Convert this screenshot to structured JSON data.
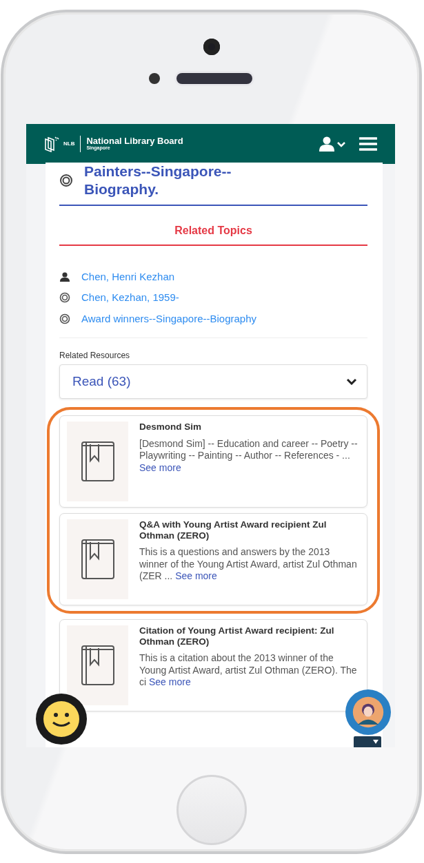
{
  "navbar": {
    "logo_mark": "NLB",
    "logo_text": "National Library Board",
    "logo_subtext": "Singapore"
  },
  "subject": {
    "title": "Painters--Singapore--Biography."
  },
  "related_topics": {
    "heading": "Related Topics",
    "items": [
      {
        "kind": "person",
        "label": "Chen, Henri Kezhan"
      },
      {
        "kind": "subject",
        "label": "Chen, Kezhan, 1959-"
      },
      {
        "kind": "subject",
        "label": "Award winners--Singapore--Biography"
      }
    ]
  },
  "related_resources": {
    "label": "Related Resources",
    "value": "Read (63)"
  },
  "results": [
    {
      "title": "Desmond Sim",
      "description": "[Desmond Sim] -- Education and career -- Poetry -- Playwriting -- Painting -- Author -- References - ...",
      "link": "See more",
      "highlighted": true
    },
    {
      "title": "Q&A with Young Artist Award recipient Zul Othman (ZERO)",
      "description": "This is a questions and answers by the 2013 winner of the Young Artist Award, artist Zul Othman (ZER ...",
      "link": "See more",
      "highlighted": true
    },
    {
      "title": "Citation of Young Artist Award recipient: Zul Othman (ZERO)",
      "description": "This is a citation about the 2013 winner of the Young Artist Award, artist Zul Othman (ZERO). The ci",
      "link": "See more",
      "highlighted": false
    }
  ]
}
